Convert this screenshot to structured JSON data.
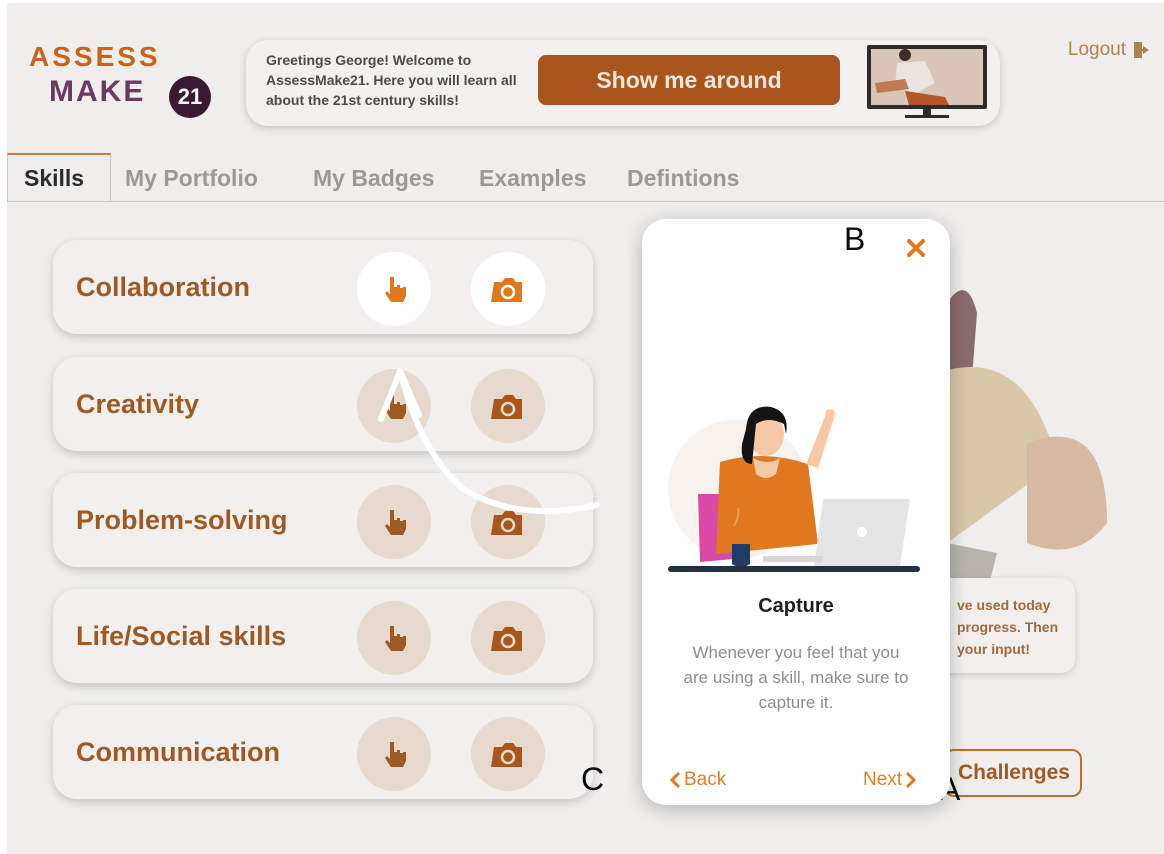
{
  "header": {
    "logo_line1": "ASSESS",
    "logo_line2": "MAKE",
    "logo_badge": "21",
    "greeting": "Greetings George! Welcome to AssessMake21. Here you will learn all about the 21st century skills!",
    "show_button": "Show me around",
    "logout": "Logout"
  },
  "tabs": [
    {
      "label": "Skills",
      "active": true
    },
    {
      "label": "My Portfolio",
      "active": false
    },
    {
      "label": "My Badges",
      "active": false
    },
    {
      "label": "Examples",
      "active": false
    },
    {
      "label": "Defintions",
      "active": false
    }
  ],
  "skills": [
    {
      "label": "Collaboration",
      "icons": [
        "hand-pointer-icon",
        "camera-icon"
      ]
    },
    {
      "label": "Creativity",
      "icons": [
        "hand-pointer-icon",
        "camera-icon"
      ]
    },
    {
      "label": "Problem-solving",
      "icons": [
        "hand-pointer-icon",
        "camera-icon"
      ]
    },
    {
      "label": "Life/Social skills",
      "icons": [
        "hand-pointer-icon",
        "camera-icon"
      ]
    },
    {
      "label": "Communication",
      "icons": [
        "hand-pointer-icon",
        "camera-icon"
      ]
    }
  ],
  "background_panel": {
    "info_text": "ve used today\n progress. Then\n your input!",
    "challenges_button": "Challenges"
  },
  "modal": {
    "title": "Capture",
    "body": "Whenever you feel that you are using a skill, make sure to capture it.",
    "back": "Back",
    "next": "Next"
  },
  "markers": {
    "b": "B",
    "c": "C",
    "a": "A"
  },
  "colors": {
    "accent": "#e0781f",
    "brand_dark": "#3a1a33",
    "overlay_text": "#9e5a24"
  }
}
